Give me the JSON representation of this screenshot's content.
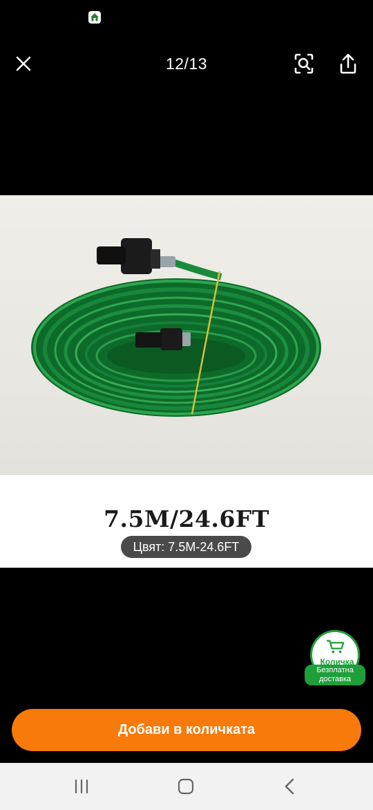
{
  "status_bar": {
    "home_icon": "home-icon"
  },
  "viewer": {
    "counter": "12/13",
    "close_icon": "close-icon",
    "lens_icon": "camera-search-icon",
    "share_icon": "share-icon"
  },
  "product": {
    "size_title": "7.5M/24.6FT",
    "color_chip": "Цвят: 7.5M-24.6FT"
  },
  "cart_badge": {
    "label": "Количка",
    "shipping": "Безплатна доставка",
    "icon": "cart-icon",
    "color": "#1f9f3a"
  },
  "cta": {
    "label": "Добави в количката",
    "color": "#f77a0a"
  },
  "nav_bar": {
    "recents_icon": "recents-icon",
    "home_icon": "home-button-icon",
    "back_icon": "back-icon"
  }
}
